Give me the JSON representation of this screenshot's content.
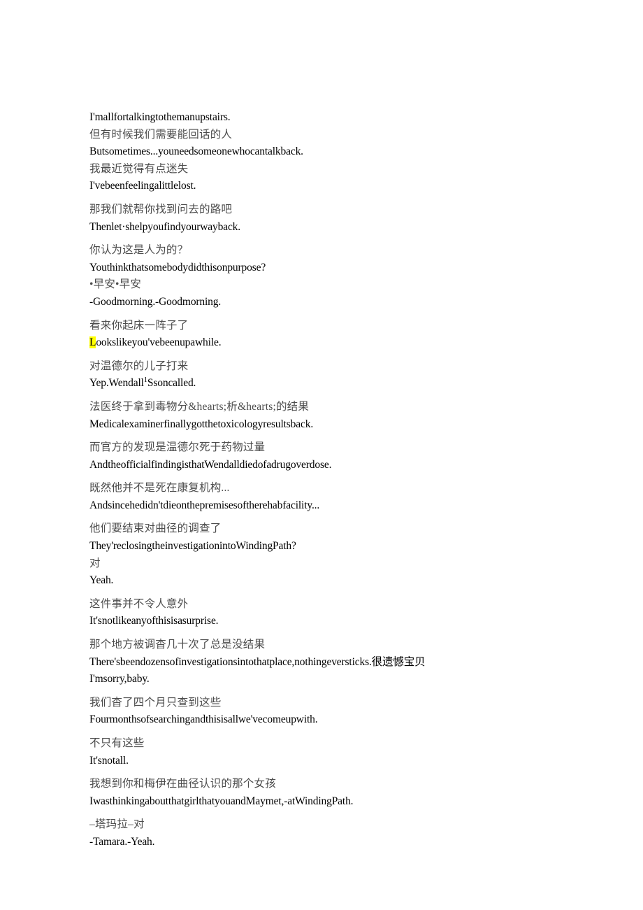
{
  "document": {
    "type": "bilingual-subtitle-transcript",
    "background_color": "#ffffff",
    "chinese_text_color": "#4c4c4c",
    "english_text_color": "#000000",
    "highlight_color": "#ffff00",
    "lines": [
      {
        "id": "l01",
        "lang": "en",
        "text": "I'mallfortalkingtothemanupstairs.",
        "gap_before": false
      },
      {
        "id": "l02",
        "lang": "zh",
        "text": "但有时候我们需要能回话的人",
        "gap_before": false
      },
      {
        "id": "l03",
        "lang": "en",
        "text": "Butsometimes...youneedsomeonewhocantalkback.",
        "gap_before": false
      },
      {
        "id": "l04",
        "lang": "zh",
        "text": "我最近觉得有点迷失",
        "gap_before": false
      },
      {
        "id": "l05",
        "lang": "en",
        "text": "I'vebeenfeelingalittlelost.",
        "gap_before": false
      },
      {
        "id": "l06",
        "lang": "zh",
        "text": "那我们就帮你找到问去的路吧",
        "gap_before": true
      },
      {
        "id": "l07",
        "lang": "en",
        "text": "Thenlet·shelpyoufindyourwayback.",
        "gap_before": false
      },
      {
        "id": "l08",
        "lang": "zh",
        "text": "你认为这是人为的？",
        "gap_before": true
      },
      {
        "id": "l09",
        "lang": "en",
        "text": "Youthinkthatsomebodydidthisonpurpose?",
        "gap_before": false
      },
      {
        "id": "l10",
        "lang": "zh",
        "text": "•早安•早安",
        "gap_before": false
      },
      {
        "id": "l11",
        "lang": "en",
        "text": "-Goodmorning.-Goodmorning.",
        "gap_before": false
      },
      {
        "id": "l12",
        "lang": "zh",
        "text": "看来你起床一阵子了",
        "gap_before": true
      },
      {
        "id": "l13",
        "lang": "en",
        "text": "ookslikeyou'vebeenupawhile.",
        "gap_before": false,
        "highlight_prefix": "L"
      },
      {
        "id": "l14",
        "lang": "zh",
        "text": "对温德尔的儿子打来",
        "gap_before": true
      },
      {
        "id": "l15",
        "lang": "en",
        "text": "Yep.Wendall",
        "gap_before": false,
        "superscript": "1",
        "text_after_sup": "Ssoncalled."
      },
      {
        "id": "l16",
        "lang": "zh",
        "text": "法医终于拿到毒物分&hearts;析&hearts;的结果",
        "gap_before": true
      },
      {
        "id": "l17",
        "lang": "en",
        "text": "Medicalexaminerfinallygotthetoxicologyresultsback.",
        "gap_before": false
      },
      {
        "id": "l18",
        "lang": "zh",
        "text": "而官方的发现是温德尔死于药物过量",
        "gap_before": true
      },
      {
        "id": "l19",
        "lang": "en",
        "text": "AndtheofficialfindingisthatWendalldiedofadrugoverdose.",
        "gap_before": false
      },
      {
        "id": "l20",
        "lang": "zh",
        "text": "既然他并不是死在康复机构...",
        "gap_before": true
      },
      {
        "id": "l21",
        "lang": "en",
        "text": "Andsincehedidn'tdieonthepremisesoftherehabfacility...",
        "gap_before": false
      },
      {
        "id": "l22",
        "lang": "zh",
        "text": "他们要结束对曲径的调查了",
        "gap_before": true
      },
      {
        "id": "l23",
        "lang": "en",
        "text": "They'reclosingtheinvestigationintoWindingPath?",
        "gap_before": false
      },
      {
        "id": "l24",
        "lang": "zh",
        "text": "对",
        "gap_before": false
      },
      {
        "id": "l25",
        "lang": "en",
        "text": "Yeah.",
        "gap_before": false
      },
      {
        "id": "l26",
        "lang": "zh",
        "text": "这件事并不令人意外",
        "gap_before": true
      },
      {
        "id": "l27",
        "lang": "en",
        "text": "It'snotlikeanyofthisisasurprise.",
        "gap_before": false
      },
      {
        "id": "l28",
        "lang": "zh",
        "text": "那个地方被调杳几十次了总是没结果",
        "gap_before": true
      },
      {
        "id": "l29",
        "lang": "en",
        "text": "There'sbeendozensofinvestigationsintothatplace,nothingeversticks.很遗憾宝贝",
        "gap_before": false
      },
      {
        "id": "l30",
        "lang": "en",
        "text": "I'msorry,baby.",
        "gap_before": false
      },
      {
        "id": "l31",
        "lang": "zh",
        "text": "我们杳了四个月只查到这些",
        "gap_before": true
      },
      {
        "id": "l32",
        "lang": "en",
        "text": "Fourmonthsofsearchingandthisisallwe'vecomeupwith.",
        "gap_before": false
      },
      {
        "id": "l33",
        "lang": "zh",
        "text": "不只有这些",
        "gap_before": true
      },
      {
        "id": "l34",
        "lang": "en",
        "text": "It'snotall.",
        "gap_before": false
      },
      {
        "id": "l35",
        "lang": "zh",
        "text": "我想到你和梅伊在曲径认识的那个女孩",
        "gap_before": true
      },
      {
        "id": "l36",
        "lang": "en",
        "text": "IwasthinkingaboutthatgirlthatyouandMaymet,-atWindingPath.",
        "gap_before": false
      },
      {
        "id": "l37",
        "lang": "zh",
        "text": "–塔玛拉–对",
        "gap_before": true
      },
      {
        "id": "l38",
        "lang": "en",
        "text": "-Tamara.-Yeah.",
        "gap_before": false
      }
    ]
  }
}
